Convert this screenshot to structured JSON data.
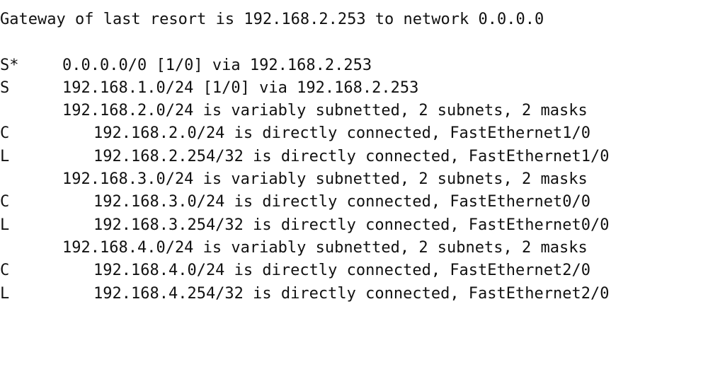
{
  "terminal": {
    "gateway_line": "Gateway of last resort is 192.168.2.253 to network 0.0.0.0",
    "routes": [
      {
        "code": "S*",
        "text": "0.0.0.0/0 [1/0] via 192.168.2.253"
      },
      {
        "code": "S",
        "text": "192.168.1.0/24 [1/0] via 192.168.2.253"
      },
      {
        "code": "",
        "text": "192.168.2.0/24 is variably subnetted, 2 subnets, 2 masks"
      },
      {
        "code": "C",
        "text": "192.168.2.0/24 is directly connected, FastEthernet1/0"
      },
      {
        "code": "L",
        "text": "192.168.2.254/32 is directly connected, FastEthernet1/0"
      },
      {
        "code": "",
        "text": "192.168.3.0/24 is variably subnetted, 2 subnets, 2 masks"
      },
      {
        "code": "C",
        "text": "192.168.3.0/24 is directly connected, FastEthernet0/0"
      },
      {
        "code": "L",
        "text": "192.168.3.254/32 is directly connected, FastEthernet0/0"
      },
      {
        "code": "",
        "text": "192.168.4.0/24 is variably subnetted, 2 subnets, 2 masks"
      },
      {
        "code": "C",
        "text": "192.168.4.0/24 is directly connected, FastEthernet2/0"
      },
      {
        "code": "L",
        "text": "192.168.4.254/32 is directly connected, FastEthernet2/0"
      }
    ]
  }
}
